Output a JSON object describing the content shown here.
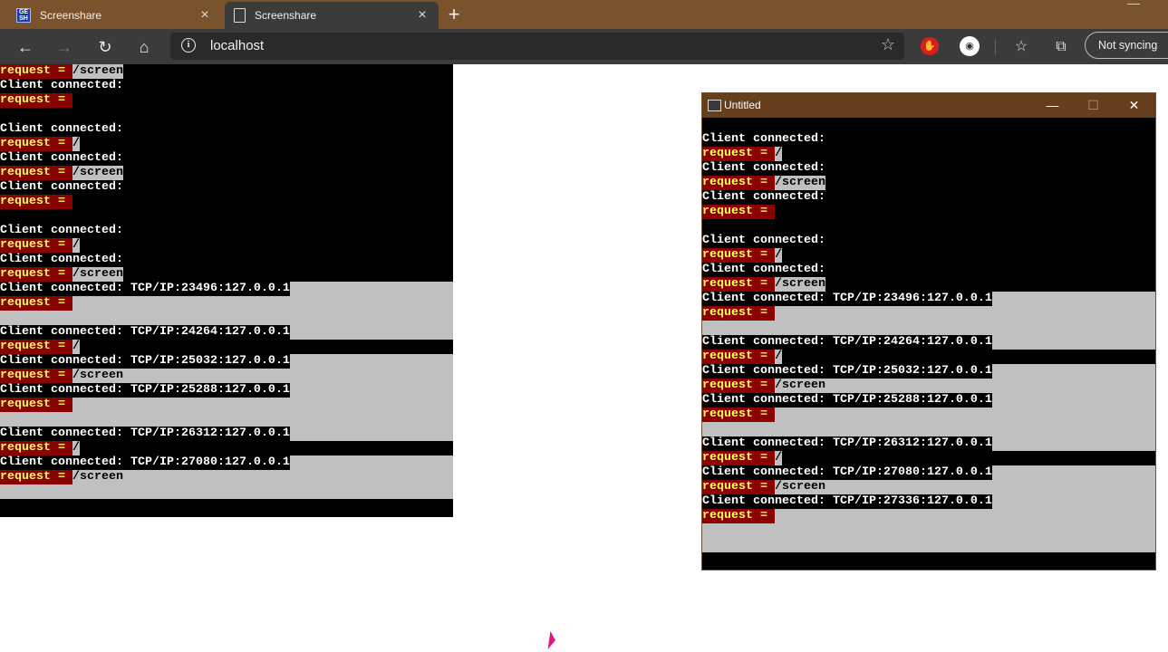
{
  "browser": {
    "tabs": [
      {
        "label": "Screenshare",
        "favicon": "gemini-icon",
        "active": false
      },
      {
        "label": "Screenshare",
        "favicon": "page-icon",
        "active": true
      }
    ],
    "address": "localhost",
    "sync_label": "Not syncing",
    "colors": {
      "titlebar": "#7a522c",
      "toolbar": "#3b3b3b"
    }
  },
  "left_console": {
    "lines": [
      [
        {
          "t": "request = ",
          "c": "req"
        },
        {
          "t": "/screen",
          "c": "pth"
        }
      ],
      [
        {
          "t": "Client connected:",
          "c": "w"
        }
      ],
      [
        {
          "t": "request = ",
          "c": "req"
        }
      ],
      [],
      [
        {
          "t": "Client connected:",
          "c": "w"
        }
      ],
      [
        {
          "t": "request = ",
          "c": "req"
        },
        {
          "t": "/",
          "c": "pth"
        }
      ],
      [
        {
          "t": "Client connected:",
          "c": "w"
        }
      ],
      [
        {
          "t": "request = ",
          "c": "req"
        },
        {
          "t": "/screen",
          "c": "pth"
        }
      ],
      [
        {
          "t": "Client connected:",
          "c": "w"
        }
      ],
      [
        {
          "t": "request = ",
          "c": "req"
        }
      ],
      [],
      [
        {
          "t": "Client connected:",
          "c": "w"
        }
      ],
      [
        {
          "t": "request = ",
          "c": "req"
        },
        {
          "t": "/",
          "c": "pth"
        }
      ],
      [
        {
          "t": "Client connected:",
          "c": "w"
        }
      ],
      [
        {
          "t": "request = ",
          "c": "req"
        },
        {
          "t": "/screen",
          "c": "pth"
        }
      ],
      [
        {
          "t": "Client connected: TCP/IP:23496:127.0.0.1",
          "c": "w"
        }
      ],
      [
        {
          "t": "request = ",
          "c": "req"
        }
      ],
      [],
      [
        {
          "t": "Client connected: TCP/IP:24264:127.0.0.1",
          "c": "w"
        }
      ],
      [
        {
          "t": "request = ",
          "c": "req"
        },
        {
          "t": "/",
          "c": "pth"
        }
      ],
      [
        {
          "t": "Client connected: TCP/IP:25032:127.0.0.1",
          "c": "w"
        }
      ],
      [
        {
          "t": "request = ",
          "c": "req"
        },
        {
          "t": "/screen",
          "c": "pth"
        }
      ],
      [
        {
          "t": "Client connected: TCP/IP:25288:127.0.0.1",
          "c": "w"
        }
      ],
      [
        {
          "t": "request = ",
          "c": "req"
        }
      ],
      [],
      [
        {
          "t": "Client connected: TCP/IP:26312:127.0.0.1",
          "c": "w"
        }
      ],
      [
        {
          "t": "request = ",
          "c": "req"
        },
        {
          "t": "/",
          "c": "pth"
        }
      ],
      [
        {
          "t": "Client connected: TCP/IP:27080:127.0.0.1",
          "c": "w"
        }
      ],
      [
        {
          "t": "request = ",
          "c": "req"
        },
        {
          "t": "/screen",
          "c": "pth"
        }
      ],
      [],
      []
    ],
    "gray_rows": [
      15,
      16,
      17,
      18,
      20,
      21,
      22,
      23,
      24,
      25,
      27,
      28,
      29
    ]
  },
  "app_window": {
    "title": "Untitled",
    "buttons": {
      "minimize": "—",
      "maximize": "☐",
      "close": "✕"
    },
    "lines": [
      [],
      [
        {
          "t": "Client connected:",
          "c": "w"
        }
      ],
      [
        {
          "t": "request = ",
          "c": "req"
        },
        {
          "t": "/",
          "c": "pth"
        }
      ],
      [
        {
          "t": "Client connected:",
          "c": "w"
        }
      ],
      [
        {
          "t": "request = ",
          "c": "req"
        },
        {
          "t": "/screen",
          "c": "pth"
        }
      ],
      [
        {
          "t": "Client connected:",
          "c": "w"
        }
      ],
      [
        {
          "t": "request = ",
          "c": "req"
        }
      ],
      [],
      [
        {
          "t": "Client connected:",
          "c": "w"
        }
      ],
      [
        {
          "t": "request = ",
          "c": "req"
        },
        {
          "t": "/",
          "c": "pth"
        }
      ],
      [
        {
          "t": "Client connected:",
          "c": "w"
        }
      ],
      [
        {
          "t": "request = ",
          "c": "req"
        },
        {
          "t": "/screen",
          "c": "pth"
        }
      ],
      [
        {
          "t": "Client connected: TCP/IP:23496:127.0.0.1",
          "c": "w"
        }
      ],
      [
        {
          "t": "request = ",
          "c": "req"
        }
      ],
      [],
      [
        {
          "t": "Client connected: TCP/IP:24264:127.0.0.1",
          "c": "w"
        }
      ],
      [
        {
          "t": "request = ",
          "c": "req"
        },
        {
          "t": "/",
          "c": "pth"
        }
      ],
      [
        {
          "t": "Client connected: TCP/IP:25032:127.0.0.1",
          "c": "w"
        }
      ],
      [
        {
          "t": "request = ",
          "c": "req"
        },
        {
          "t": "/screen",
          "c": "pth"
        }
      ],
      [
        {
          "t": "Client connected: TCP/IP:25288:127.0.0.1",
          "c": "w"
        }
      ],
      [
        {
          "t": "request = ",
          "c": "req"
        }
      ],
      [],
      [
        {
          "t": "Client connected: TCP/IP:26312:127.0.0.1",
          "c": "w"
        }
      ],
      [
        {
          "t": "request = ",
          "c": "req"
        },
        {
          "t": "/",
          "c": "pth"
        }
      ],
      [
        {
          "t": "Client connected: TCP/IP:27080:127.0.0.1",
          "c": "w"
        }
      ],
      [
        {
          "t": "request = ",
          "c": "req"
        },
        {
          "t": "/screen",
          "c": "pth"
        }
      ],
      [
        {
          "t": "Client connected: TCP/IP:27336:127.0.0.1",
          "c": "w"
        }
      ],
      [
        {
          "t": "request = ",
          "c": "req"
        }
      ],
      [],
      [],
      []
    ],
    "gray_rows": [
      12,
      13,
      14,
      15,
      17,
      18,
      19,
      20,
      21,
      22,
      24,
      25,
      26,
      27,
      28,
      29
    ]
  }
}
